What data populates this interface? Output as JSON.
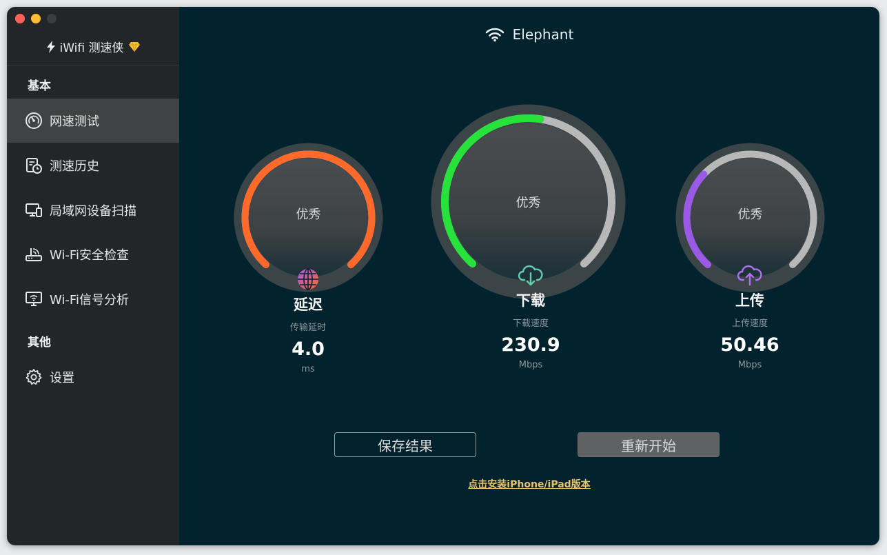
{
  "app": {
    "title": "iWifi 测速侠"
  },
  "sidebar": {
    "section_basic": "基本",
    "section_other": "其他",
    "items": [
      {
        "label": "网速测试",
        "icon": "speedometer-icon",
        "active": true
      },
      {
        "label": "测速历史",
        "icon": "history-icon",
        "active": false
      },
      {
        "label": "局域网设备扫描",
        "icon": "devices-icon",
        "active": false
      },
      {
        "label": "Wi-Fi安全检查",
        "icon": "router-icon",
        "active": false
      },
      {
        "label": "Wi-Fi信号分析",
        "icon": "signal-monitor-icon",
        "active": false
      }
    ],
    "settings_label": "设置"
  },
  "network": {
    "name": "Elephant",
    "icon": "wifi-icon"
  },
  "gauges": {
    "latency": {
      "rating": "优秀",
      "title": "延迟",
      "subtitle": "传输延时",
      "value": "4.0",
      "unit": "ms",
      "fill": 1.0,
      "color": "#ff6a2b",
      "icon": "globe-icon"
    },
    "download": {
      "rating": "优秀",
      "title": "下载",
      "subtitle": "下载速度",
      "value": "230.9",
      "unit": "Mbps",
      "fill": 0.53,
      "color": "#27e23b",
      "icon": "cloud-download-icon"
    },
    "upload": {
      "rating": "优秀",
      "title": "上传",
      "subtitle": "上传速度",
      "value": "50.46",
      "unit": "Mbps",
      "fill": 0.33,
      "color": "#9b59e8",
      "icon": "cloud-upload-icon"
    }
  },
  "buttons": {
    "save": "保存结果",
    "restart": "重新开始"
  },
  "install_link": "点击安装iPhone/iPad版本",
  "colors": {
    "main_bg": "#02222d",
    "sidebar_bg": "#232628",
    "track": "#b8b8b8",
    "link": "#e9c46a"
  }
}
